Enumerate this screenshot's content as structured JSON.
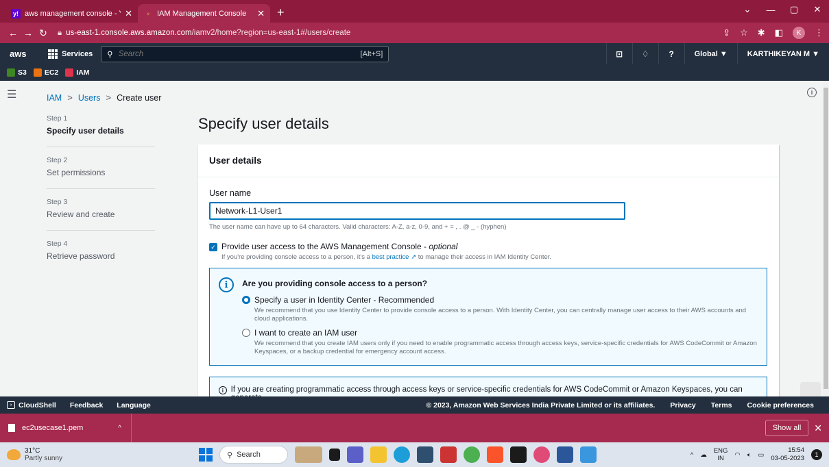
{
  "browser": {
    "tabs": [
      {
        "title": "aws management console - Yaho",
        "active": false
      },
      {
        "title": "IAM Management Console",
        "active": true
      }
    ],
    "new_tab": "+",
    "url_prefix": "us-east-1.console.aws.amazon.com",
    "url_path": "/iamv2/home?region=us-east-1#/users/create",
    "profile_initial": "K"
  },
  "aws_header": {
    "logo": "aws",
    "services_label": "Services",
    "search_placeholder": "Search",
    "search_shortcut": "[Alt+S]",
    "region": "Global ▼",
    "account": "KARTHIKEYAN M ▼"
  },
  "favorites": [
    {
      "label": "S3",
      "color": "#3f8624"
    },
    {
      "label": "EC2",
      "color": "#ec7211"
    },
    {
      "label": "IAM",
      "color": "#dd344c"
    }
  ],
  "breadcrumb": {
    "items": [
      "IAM",
      "Users",
      "Create user"
    ],
    "separator": ">"
  },
  "steps": [
    {
      "num": "Step 1",
      "label": "Specify user details",
      "current": true
    },
    {
      "num": "Step 2",
      "label": "Set permissions",
      "current": false
    },
    {
      "num": "Step 3",
      "label": "Review and create",
      "current": false
    },
    {
      "num": "Step 4",
      "label": "Retrieve password",
      "current": false
    }
  ],
  "page_title": "Specify user details",
  "panel": {
    "heading": "User details",
    "username_label": "User name",
    "username_value": "Network-L1-User1",
    "username_hint": "The user name can have up to 64 characters. Valid characters: A-Z, a-z, 0-9, and + = , . @ _ - (hyphen)",
    "console_access_label": "Provide user access to the AWS Management Console - ",
    "console_access_optional": "optional",
    "console_access_sub_prefix": "If you're providing console access to a person, it's a ",
    "console_access_link": "best practice",
    "console_access_sub_suffix": " to manage their access in IAM Identity Center.",
    "question": "Are you providing console access to a person?",
    "radio1_label": "Specify a user in Identity Center - Recommended",
    "radio1_desc": "We recommend that you use Identity Center to provide console access to a person. With Identity Center, you can centrally manage user access to their AWS accounts and cloud applications.",
    "radio2_label": "I want to create an IAM user",
    "radio2_desc": "We recommend that you create IAM users only if you need to enable programmatic access through access keys, service-specific credentials for AWS CodeCommit or Amazon Keyspaces, or a backup credential for emergency account access.",
    "info2": "If you are creating programmatic access through access keys or service-specific credentials for AWS CodeCommit or Amazon Keyspaces, you can generate"
  },
  "footer": {
    "cloudshell": "CloudShell",
    "feedback": "Feedback",
    "language": "Language",
    "copyright": "© 2023, Amazon Web Services India Private Limited or its affiliates.",
    "privacy": "Privacy",
    "terms": "Terms",
    "cookies": "Cookie preferences"
  },
  "downloads": {
    "file": "ec2usecase1.pem",
    "show_all": "Show all"
  },
  "taskbar": {
    "temp": "31°C",
    "weather": "Partly sunny",
    "search": "Search",
    "lang1": "ENG",
    "lang2": "IN",
    "time": "15:54",
    "date": "03-05-2023",
    "notifications": "1"
  }
}
